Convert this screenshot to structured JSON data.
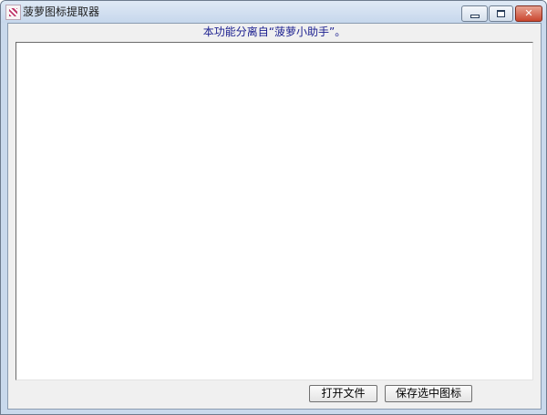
{
  "window": {
    "title": "菠萝图标提取器",
    "icon": "pineapple-app-icon",
    "controls": {
      "minimize_icon": "minimize-icon",
      "maximize_icon": "maximize-icon",
      "close_icon": "close-icon",
      "close_glyph": "✕"
    }
  },
  "main": {
    "subtitle": "本功能分离自“菠萝小助手”。",
    "icon_list": {
      "items": []
    }
  },
  "footer": {
    "open_file_label": "打开文件",
    "save_selected_label": "保存选中图标"
  },
  "colors": {
    "subtitle_text": "#1b1f8f",
    "close_button": "#c9462e",
    "titlebar": "#c6d7ec"
  }
}
